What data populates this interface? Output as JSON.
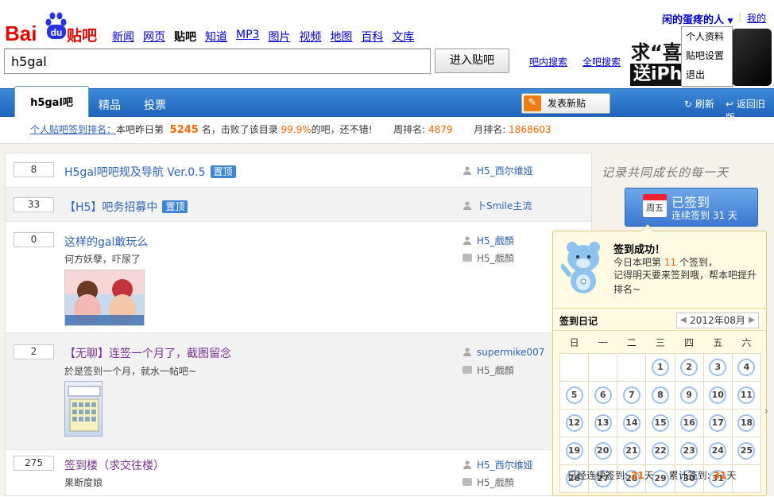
{
  "header": {
    "nav": [
      {
        "label": "新闻",
        "current": false
      },
      {
        "label": "网页",
        "current": false
      },
      {
        "label": "贴吧",
        "current": true
      },
      {
        "label": "知道",
        "current": false
      },
      {
        "label": "MP3",
        "current": false
      },
      {
        "label": "图片",
        "current": false
      },
      {
        "label": "视频",
        "current": false
      },
      {
        "label": "地图",
        "current": false
      },
      {
        "label": "百科",
        "current": false
      },
      {
        "label": "文库",
        "current": false
      }
    ],
    "search_value": "h5gal",
    "search_button": "进入贴吧",
    "search_in_bar": "吧内搜索",
    "search_all": "全吧搜索",
    "user_name": "闲的蛋疼的人",
    "my_link": "我的",
    "user_menu": [
      "个人资料",
      "贴吧设置",
      "退出"
    ],
    "ad_line1": "求“喜",
    "ad_line2": "送iPho"
  },
  "tabs": {
    "active": "h5gal吧",
    "items": [
      "精品",
      "投票"
    ],
    "post_button": "发表新贴",
    "refresh": "刷新",
    "back_old": "返回旧版"
  },
  "rank": {
    "label": "个人贴吧签到排名：",
    "prefix": "本吧昨日第",
    "yesterday_rank": "5245",
    "mid": "名，击败了该目录",
    "percent": "99.9%",
    "suffix": "的吧，还不错!",
    "week_label": "周排名:",
    "week_rank": "4879",
    "month_label": "月排名:",
    "month_rank": "1868603"
  },
  "threads": [
    {
      "replies": "8",
      "title": "H5gal吧吧规及导航  Ver.0.5",
      "tag": "置顶",
      "author": "H5_西尔维娅",
      "abstract": "",
      "last_reply": ""
    },
    {
      "replies": "33",
      "title": "【H5】吧务招募中",
      "tag": "置顶",
      "author": "卜Smile主流",
      "abstract": "",
      "last_reply": ""
    },
    {
      "replies": "0",
      "title": "这样的gal敢玩么",
      "tag": "",
      "author": "H5_戲顏",
      "abstract": "何方妖孽，吓尿了",
      "last_reply": "H5_戲顏"
    },
    {
      "replies": "2",
      "title": "【无聊】连签一个月了，截图留念",
      "tag": "",
      "author": "supermike007",
      "abstract": "於是签到一个月，就水一帖吧~",
      "last_reply": "H5_戲顏"
    },
    {
      "replies": "275",
      "title": "签到楼（求交往楼）",
      "tag": "",
      "author": "H5_西尔维娅",
      "abstract": "果断度娘",
      "last_reply": "H5_戲顏"
    }
  ],
  "sidebar": {
    "motto": "记录共同成长的每一天",
    "sign_status": "已签到",
    "sign_streak": "连续签到 31 天",
    "sign_weekday": "周五"
  },
  "popup": {
    "title": "签到成功！",
    "today_prefix": "今日本吧第",
    "today_count": "11",
    "today_suffix": "个签到，",
    "tip": "记得明天要来签到哦，帮本吧提升排名~",
    "diary_title": "签到日记",
    "month": "2012年08月",
    "weekdays": [
      "日",
      "一",
      "二",
      "三",
      "四",
      "五",
      "六"
    ],
    "footer_streak_label": "已经连续签到:",
    "footer_streak": "31",
    "footer_total_label": "累计签到:",
    "footer_total": "31",
    "day_unit": "天"
  },
  "calendar": {
    "first_weekday": 3,
    "days": 31
  }
}
